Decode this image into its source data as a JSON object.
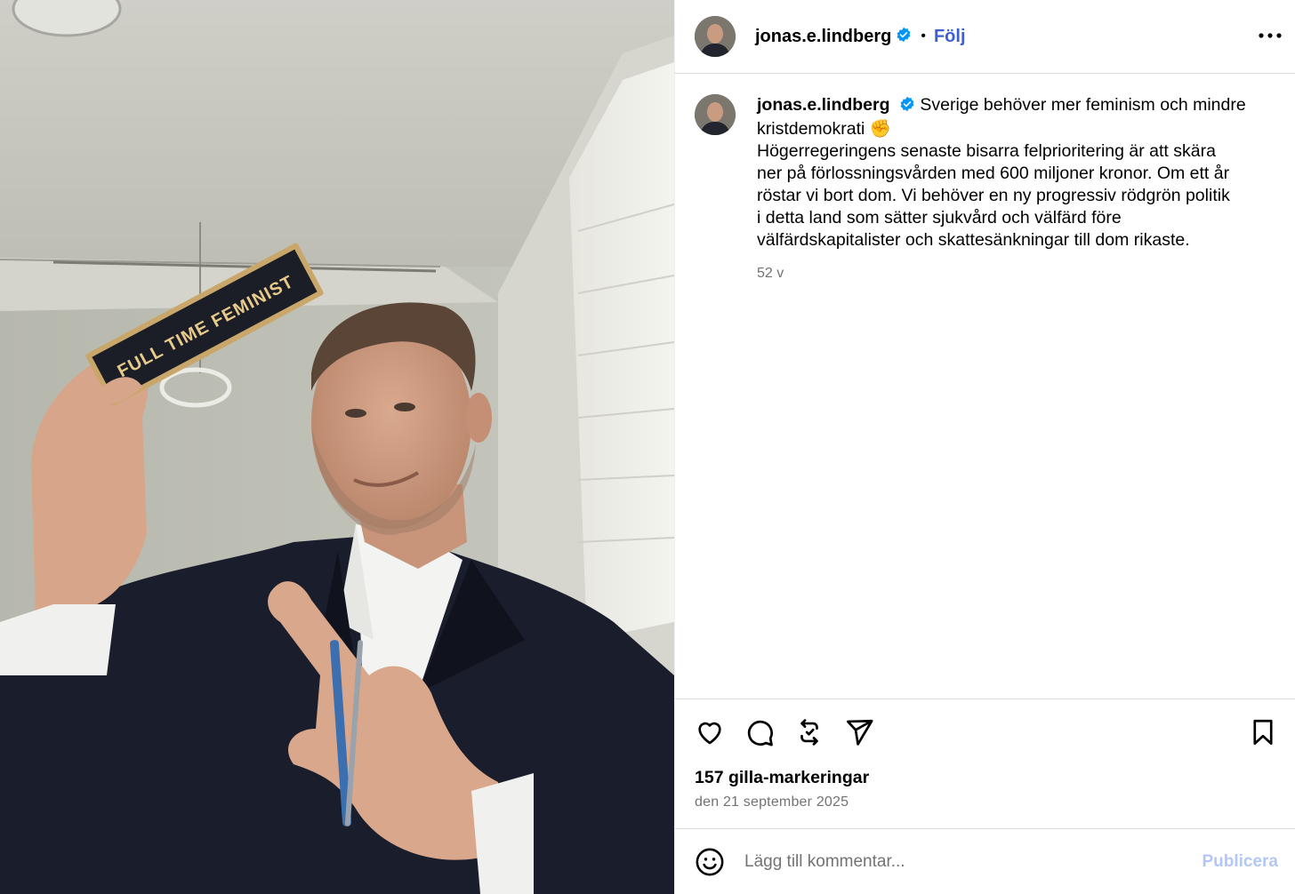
{
  "post": {
    "username": "jonas.e.lindberg",
    "follow_label": "Följ",
    "more_icon": "more-horizontal-icon",
    "verified_icon": "verified-badge-icon",
    "photo": {
      "plaque_text": "FULL TIME FEMINIST",
      "description_icon": "post-photo"
    }
  },
  "caption": {
    "username": "jonas.e.lindberg",
    "lines": [
      "Sverige behöver mer feminism och mindre",
      "kristdemokrati ✊",
      "Högerregeringens senaste bisarra felprioritering är att skära",
      "ner på förlossningsvården med 600 miljoner kronor. Om ett år",
      "röstar vi bort dom. Vi behöver en ny progressiv rödgrön politik",
      "i detta land som sätter sjukvård och välfärd före",
      "välfärdskapitalister och skattesänkningar till dom rikaste."
    ],
    "age": "52 v"
  },
  "actions": {
    "icons": [
      "heart-icon",
      "comment-icon",
      "repost-icon",
      "share-icon",
      "bookmark-icon"
    ],
    "likes": "157 gilla-markeringar",
    "date": "den 21 september 2025"
  },
  "comment": {
    "placeholder": "Lägg till kommentar...",
    "publish_label": "Publicera",
    "emoji_icon": "emoji-icon"
  },
  "colors": {
    "accent": "#0095f6",
    "follow": "#3c5fd6",
    "publish_disabled": "#b3c7f7",
    "secondary_text": "#737373",
    "divider": "#dbdbdb"
  }
}
